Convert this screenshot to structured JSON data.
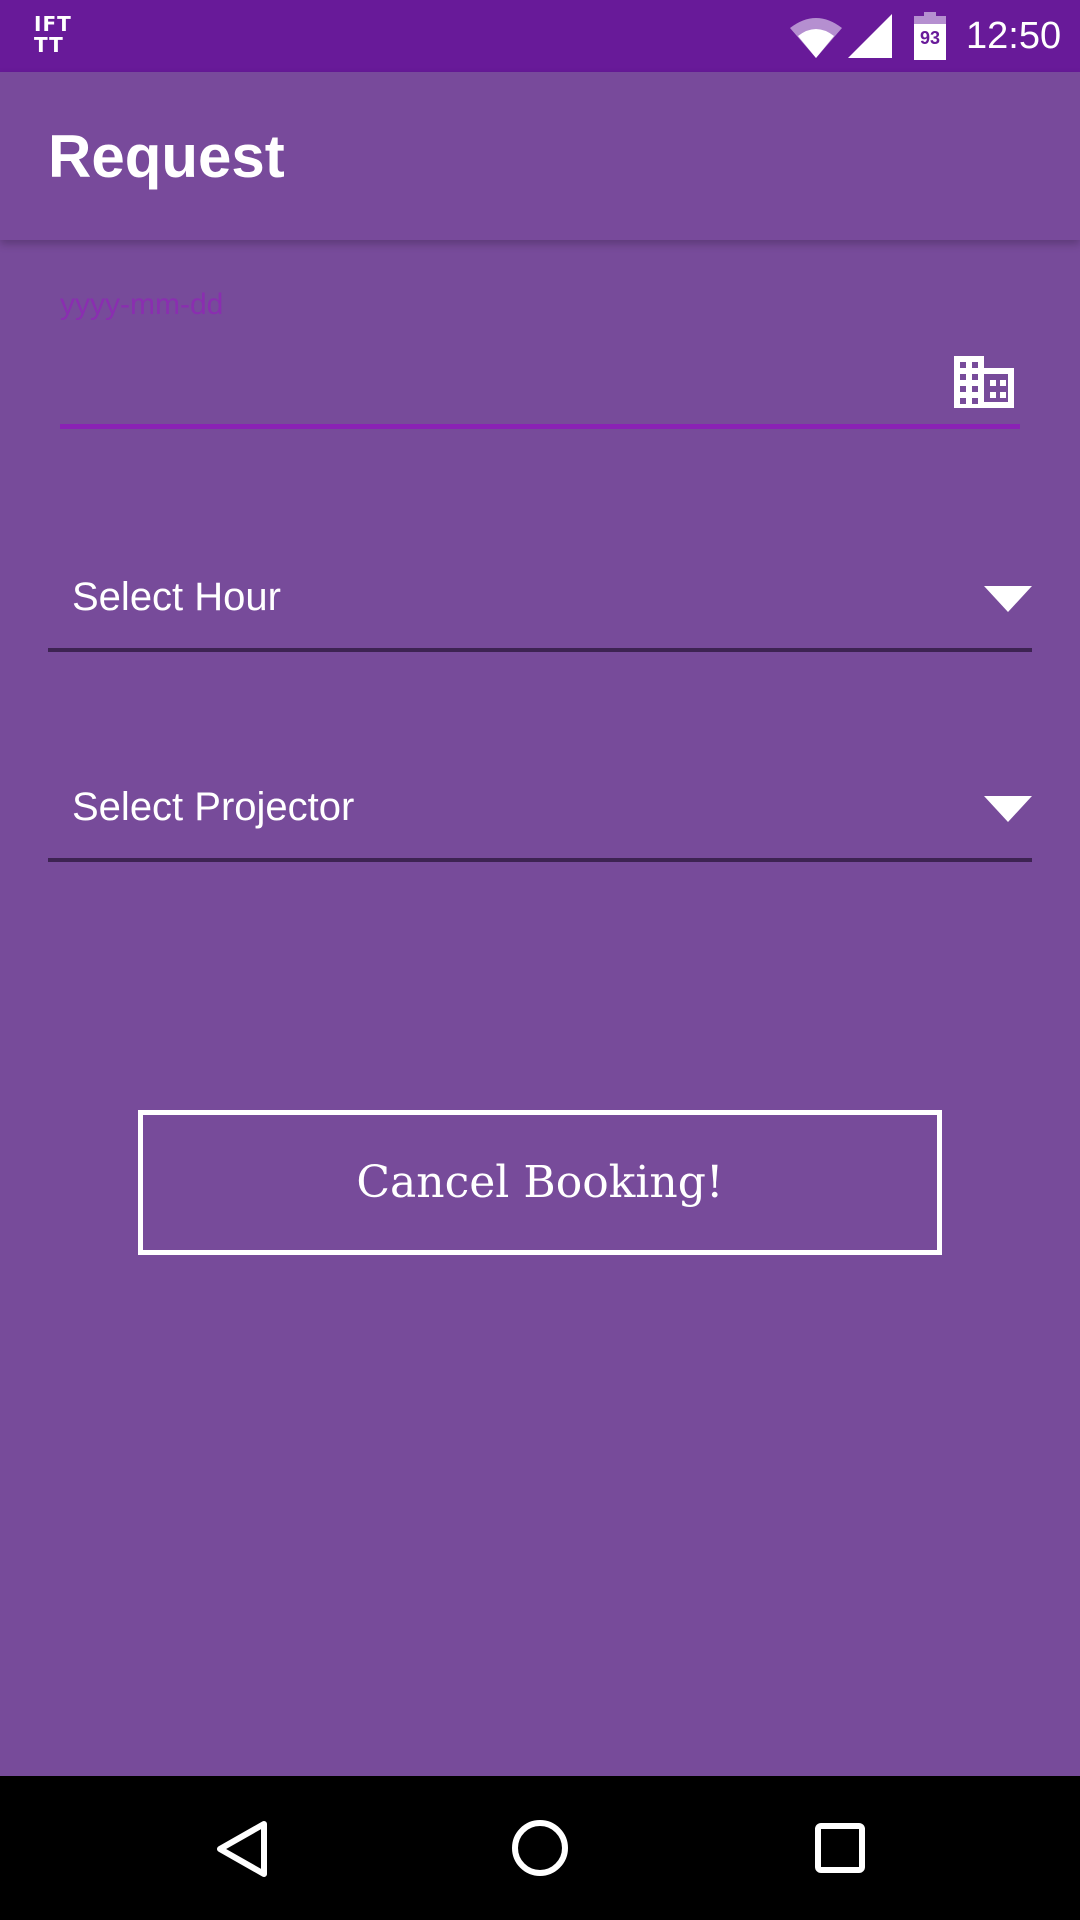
{
  "status_bar": {
    "app_logo": "IFTTT",
    "battery_level": "93",
    "time": "12:50",
    "icons": [
      "ifttt-logo",
      "wifi-icon",
      "cell-signal-icon",
      "battery-icon"
    ]
  },
  "app_bar": {
    "title": "Request"
  },
  "form": {
    "date": {
      "placeholder": "yyyy-mm-dd",
      "value": "",
      "icon": "building-icon"
    },
    "hour_spinner": {
      "selected": "Select Hour",
      "icon": "dropdown-arrow-icon"
    },
    "projector_spinner": {
      "selected": "Select Projector",
      "icon": "dropdown-arrow-icon"
    },
    "cancel_button_label": "Cancel Booking!"
  },
  "nav_bar": {
    "icons": [
      "back-icon",
      "home-icon",
      "recents-icon"
    ]
  },
  "colors": {
    "status_bar": "#681a99",
    "app_bar": "#784a9b",
    "background": "#774b9a",
    "accent": "#8a22b5",
    "nav_bar": "#000000"
  }
}
